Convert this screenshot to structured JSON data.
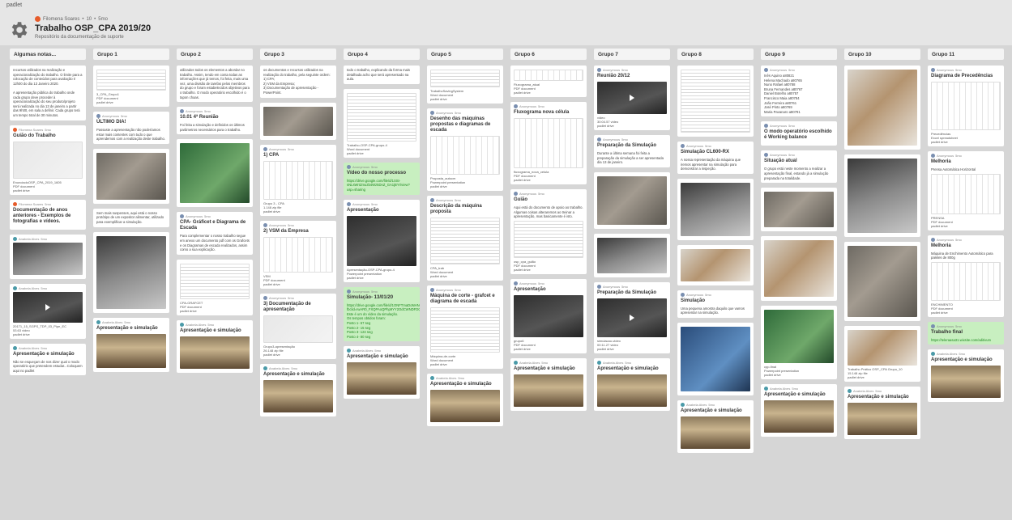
{
  "app": {
    "brand": "padlet"
  },
  "header": {
    "breadcrumb": [
      "Filomena Soares",
      "10",
      "5mo"
    ],
    "title": "Trabalho OSP_CPA 2019/20",
    "subtitle": "Repositório da documentação de suporte"
  },
  "columns": [
    {
      "name": "Algumas notas...",
      "posts": [
        {
          "body": "recursos utilizados na realização e operacionalização do trabalho. O limite para a colocação de conteúdos para avaliação é 12h00 do dia 13 Janeiro 2020.\n\nA apresentação pública do trabalho onde cada grupo deve proceder à operacionalização do seu produto/projeto será realizada no dia 13 de janeiro a partir das 9h00, em sala a definir. Cada grupo terá um tempo total de 30 minutos."
        },
        {
          "author": "Filomena Soares",
          "time": "5mo",
          "title": "Guião do Trabalho",
          "img": "im-red",
          "imgh": 46,
          "caption": "EnunciadoOSP_CPA_2019_1605",
          "type": "PDF document",
          "source": "padlet drive"
        },
        {
          "author": "Filomena Soares",
          "time": "5mo",
          "title": "Documentação de anos anteriores - Exemplos de fotografias e vídeos."
        },
        {
          "author": "Anabela Alves",
          "time": "5mo",
          "img": "im-lab",
          "imgh": 40
        },
        {
          "author": "Anabela Alves",
          "time": "5mo",
          "img": "im-dark",
          "imgh": 38,
          "video": true,
          "caption": "20171_15_SGPS_TDP_03_Pipe_EC",
          "type": "53.63 video",
          "source": "padlet drive"
        },
        {
          "author": "Anabela Alves",
          "time": "5mo",
          "title": "Apresentação e simulação",
          "body": "Não se esqueçam de nos dizer qual o modo operatório que pretendem estudar...Coloquem aqui no padlet"
        }
      ]
    },
    {
      "name": "Grupo 1",
      "posts": [
        {
          "img": "im-doc",
          "imgh": 26,
          "caption": "3_CPA_Grupo1",
          "type": "PDF document",
          "source": "padlet drive"
        },
        {
          "author": "Anonymous",
          "time": "5mo",
          "title": "ÚLTIMO DIA!",
          "body": "Passaste a apresentação não poderíamos estar mais contentes com tudo o que aprendemos com a realização deste trabalho."
        },
        {
          "img": "im-photo",
          "imgh": 58
        },
        {
          "body": "Sem mais suspenses, aqui está o nosso protótipo de um expositor alimentar, utilizado para exemplificar a simulação."
        },
        {
          "img": "im-lab",
          "imgh": 90
        },
        {
          "author": "Anabela Alves",
          "time": "5mo",
          "title": "Apresentação e simulação",
          "img": "im-room",
          "imgh": 42
        }
      ]
    },
    {
      "name": "Grupo 2",
      "posts": [
        {
          "body": "utilizados todos os elementos a abordar no trabalho. Assim, tendo em conta todas as informações que já temos, foi feita, mais uma vez, uma divisão de tarefas pelos membros do grupo e foram estabelecidos objetivos para o trabalho. O modo operatório escolhido é o tapon chaas."
        },
        {
          "author": "Anonymous",
          "time": "5mo",
          "title": "10.01 4ª Reunião",
          "body": "Foi feita a simulação e definidos os últimos parâmetros necessários para o trabalho."
        },
        {
          "img": "im-green",
          "imgh": 74
        },
        {
          "author": "Anonymous",
          "time": "5mo",
          "title": "CPA- Gráficet e Diagrama de Escada",
          "body": "Para complementar o nosso trabalho segue em anexo um documento pdf com os Grafcets e os Diagramas de escada realizados, assim como a sua explicação."
        },
        {
          "img": "im-doc",
          "imgh": 44,
          "caption": "CPA-GRAFCET",
          "type": "PDF document",
          "source": "padlet drive"
        },
        {
          "author": "Anabela Alves",
          "time": "5mo",
          "title": "Apresentação e simulação",
          "img": "im-room",
          "imgh": 40
        }
      ]
    },
    {
      "name": "Grupo 3",
      "posts": [
        {
          "body": "os documentos e recursos utilizados na realização do trabalho, pela seguinte ordem:\n1) CPA;\n2) VSM da Empresa;\n3) Documentação de apresentação - PowerPoint."
        },
        {
          "img": "im-photo",
          "imgh": 36
        },
        {
          "author": "Anonymous",
          "time": "5mo",
          "title": "1) CPA",
          "img": "im-diag",
          "imgh": 48,
          "caption": "Grupo 3 - CPA",
          "type": "1.148 zip file",
          "source": "padlet drive"
        },
        {
          "author": "Anonymous",
          "time": "5mo",
          "title": "2) VSM da Empresa",
          "img": "im-diag",
          "imgh": 44,
          "caption": "VSM",
          "type": "PDF document",
          "source": "padlet drive"
        },
        {
          "author": "Anonymous",
          "time": "5mo",
          "title": "3) Documentação de apresentação",
          "img": "im-red",
          "imgh": 34,
          "caption": "Grupo3-apresentação",
          "type": "26.148 zip file",
          "source": "padlet drive"
        },
        {
          "author": "Anabela Alves",
          "time": "5mo",
          "title": "Apresentação e simulação",
          "img": "im-room",
          "imgh": 40
        }
      ]
    },
    {
      "name": "Grupo 4",
      "posts": [
        {
          "body": "todo o trabalho, explicando da forma mais detalhada acho que será apresentado na aula."
        },
        {
          "img": "im-doc",
          "imgh": 60,
          "caption": "Trabalho-OSP-CPA-grupo-4",
          "type": "Word document",
          "source": "padlet drive"
        },
        {
          "author": "Anonymous",
          "time": "5mo",
          "title": "Vídeo do nosso processo",
          "green": true,
          "body": "https://drive.google.com/file/d/1SSt-sNLsWrIZmuzb4Wz5DnZ_GA1jBYr/view?usp=sharing"
        },
        {
          "author": "Anonymous",
          "time": "5mo",
          "title": "Apresentação",
          "img": "im-dark",
          "imgh": 62,
          "caption": "Apresentação-OSP-CPA-grupo-4",
          "type": "Powerpoint presentation",
          "source": "padlet drive"
        },
        {
          "author": "Anonymous",
          "time": "5mo",
          "title": "Simulação- 13/01/20",
          "green": true,
          "body": "https://drive.google.com/file/d/1ONFTmaDoNHNQgRuTpSiaspRTaLN/view?fbclid=IwAR0_FXQPAoQPhp9YY2OdCWNDFDQgPfH_YYYVwRtr3rb9Cmp/Inventariables\nEste é um do vídeo da simulação.\nOs tempos obtidos foram:\nPosto 1- 67 seg\nPosto 2- 15 seg\nPosto 3- 124 seg\nPosto 4- 80 seg"
        },
        {
          "author": "Anabela Alves",
          "time": "5mo",
          "title": "Apresentação e simulação",
          "img": "im-room",
          "imgh": 40
        }
      ]
    },
    {
      "name": "Grupo 5",
      "posts": [
        {
          "img": "im-doc",
          "imgh": 22,
          "caption": "TrabalhoSavingSystem",
          "type": "Word document",
          "source": "padlet drive"
        },
        {
          "author": "Anonymous",
          "time": "5mo",
          "title": "Desenho das máquinas propostas e diagramas de escada",
          "img": "im-diag",
          "imgh": 48,
          "caption": "Proposta_autocm",
          "type": "Powerpoint presentation",
          "source": "padlet drive"
        },
        {
          "author": "Anonymous",
          "time": "5mo",
          "title": "Descrição da máquina proposta",
          "img": "im-doc",
          "imgh": 58,
          "caption": "CPA_trab",
          "type": "Word document",
          "source": "padlet drive"
        },
        {
          "author": "Anonymous",
          "time": "5mo",
          "title": "Máquina de corte - grafcet e diagrama de escada",
          "img": "im-doc",
          "imgh": 56,
          "caption": "Máquina-de-corte",
          "type": "Word document",
          "source": "padlet drive"
        },
        {
          "author": "Anabela Alves",
          "time": "5mo",
          "title": "Apresentação e simulação",
          "img": "im-room",
          "imgh": 40
        }
      ]
    },
    {
      "name": "Grupo 6",
      "posts": [
        {
          "img": "im-diag",
          "imgh": 14,
          "caption": "Fluxograma_atual",
          "type": "PDF document",
          "source": "padlet drive"
        },
        {
          "author": "Anonymous",
          "time": "5mo",
          "title": "Fluxograma nova célula",
          "img": "im-diag",
          "imgh": 62,
          "caption": "fluxograma_nova_celula",
          "type": "PDF document",
          "source": "padlet drive"
        },
        {
          "author": "Anonymous",
          "time": "5mo",
          "title": "Guião",
          "body": "Aqui está do documento de apoio ao trabalho. Algumas coisas alteraremos ao treinar a apresentação, mas basicamente é isto.",
          "img": "im-doc",
          "imgh": 46,
          "caption": "osp_cpa_guião",
          "type": "PDF document",
          "source": "padlet drive"
        },
        {
          "author": "Anonymous",
          "time": "5mo",
          "title": "Apresentação",
          "img": "im-dark",
          "imgh": 52,
          "caption": "grupo6",
          "type": "PDF document",
          "source": "padlet drive"
        },
        {
          "author": "Anabela Alves",
          "time": "5mo",
          "title": "Apresentação e simulação",
          "img": "im-room",
          "imgh": 40
        }
      ]
    },
    {
      "name": "Grupo 7",
      "posts": [
        {
          "author": "Anonymous",
          "time": "5mo",
          "title": "Reunião 20/12",
          "img": "im-dark",
          "imgh": 40,
          "video": true,
          "caption": "video",
          "type": "30:04.57 video",
          "source": "padlet drive"
        },
        {
          "author": "Anonymous",
          "time": "5mo",
          "title": "Preparação da Simulação",
          "body": "Durante a última semana foi feita a preparação da simulação a ser apresentada dia 13 de janeiro."
        },
        {
          "img": "im-photo",
          "imgh": 60
        },
        {
          "img": "im-lab",
          "imgh": 44
        },
        {
          "author": "Anonymous",
          "time": "5mo",
          "title": "Preparação da Simulação",
          "img": "im-dark",
          "imgh": 48,
          "video": true,
          "caption": "simulacao-video",
          "type": "00:11.27 video",
          "source": "padlet drive"
        },
        {
          "author": "Anabela Alves",
          "time": "5mo",
          "title": "Apresentação e simulação",
          "img": "im-room",
          "imgh": 40
        }
      ]
    },
    {
      "name": "Grupo 8",
      "posts": [
        {
          "img": "im-doc",
          "imgh": 78
        },
        {
          "author": "Anonymous",
          "time": "5mo",
          "title": "Simulação CL600-RX",
          "body": "A nossa representação da máquina que iremos apresentar na simulação para demonstrar a inspeção."
        },
        {
          "img": "im-lab",
          "imgh": 66
        },
        {
          "img": "im-box",
          "imgh": 40
        },
        {
          "author": "Anonymous",
          "time": "5mo",
          "title": "Simulação",
          "body": "Uma pequena amostra daquilo que vamos apresentar na simulação."
        },
        {
          "img": "im-blue",
          "imgh": 80
        },
        {
          "author": "Anabela Alves",
          "time": "5mo",
          "title": "Apresentação e simulação",
          "img": "im-room",
          "imgh": 40
        }
      ]
    },
    {
      "name": "Grupo 9",
      "posts": [
        {
          "author": "Anonymous",
          "time": "5mo",
          "body": "Inês Aquino a80821\nHelena Machado a80765\nNuno Rafael a80788\nBruna Fernandes a80767\nDaniel Botelho a80757\nFrancisco Maia a80784\nJoão Ferreira a80761\nJosé Pinto a80769\nMaria Pavanaro a80791"
        },
        {
          "author": "Anonymous",
          "time": "5mo",
          "title": "O modo operatório escolhido é Working balance"
        },
        {
          "author": "Anonymous",
          "time": "5mo",
          "title": "Situação atual",
          "body": "O grupo está neste momento a realizar a apresentação final, estando já a simulação preparada na totalidade."
        },
        {
          "img": "im-photo",
          "imgh": 44
        },
        {
          "img": "im-box",
          "imgh": 70
        },
        {
          "img": "im-green",
          "imgh": 66,
          "caption": "cpp-final",
          "type": "Powerpoint presentation",
          "source": "padlet drive"
        },
        {
          "author": "Anabela Alves",
          "time": "5mo",
          "title": "Apresentação e simulação",
          "img": "im-room",
          "imgh": 40
        }
      ]
    },
    {
      "name": "Grupo 10",
      "posts": [
        {
          "img": "im-box",
          "imgh": 94
        },
        {
          "img": "im-lab",
          "imgh": 92
        },
        {
          "img": "im-photo",
          "imgh": 88
        },
        {
          "img": "im-box",
          "imgh": 44,
          "caption": "Trabalho Prático OSP_CPA Grupo_10",
          "type": "15.148 zip file",
          "source": "padlet drive"
        },
        {
          "author": "Anabela Alves",
          "time": "5mo",
          "title": "Apresentação e simulação",
          "img": "im-room",
          "imgh": 40
        }
      ]
    },
    {
      "name": "Grupo 11",
      "posts": [
        {
          "author": "Anonymous",
          "time": "5mo",
          "title": "Diagrama de Precedências",
          "img": "im-diag",
          "imgh": 60,
          "caption": "Precedências",
          "type": "Excel spreadsheet",
          "source": "padlet drive"
        },
        {
          "author": "Anonymous",
          "time": "5mo",
          "title": "Melhoria",
          "body": "Prensa Automática Horizontal",
          "img": "im-diag",
          "imgh": 50,
          "caption": "PRENSA",
          "type": "PDF document",
          "source": "padlet drive"
        },
        {
          "author": "Anonymous",
          "time": "5mo",
          "title": "Melhoria",
          "body": "Máquina de Enchimento Automático para paletes de 800g",
          "img": "im-diag",
          "imgh": 48,
          "caption": "ENCHIMENTO",
          "type": "PDF document",
          "source": "padlet drive"
        },
        {
          "author": "Anonymous",
          "time": "5mo",
          "title": "Trabalho final",
          "green": true,
          "body": "https://teleraasa31.wixsite.com/aditivum"
        },
        {
          "author": "Anabela Alves",
          "time": "5mo",
          "title": "Apresentação e simulação",
          "img": "im-room",
          "imgh": 40
        }
      ]
    }
  ]
}
